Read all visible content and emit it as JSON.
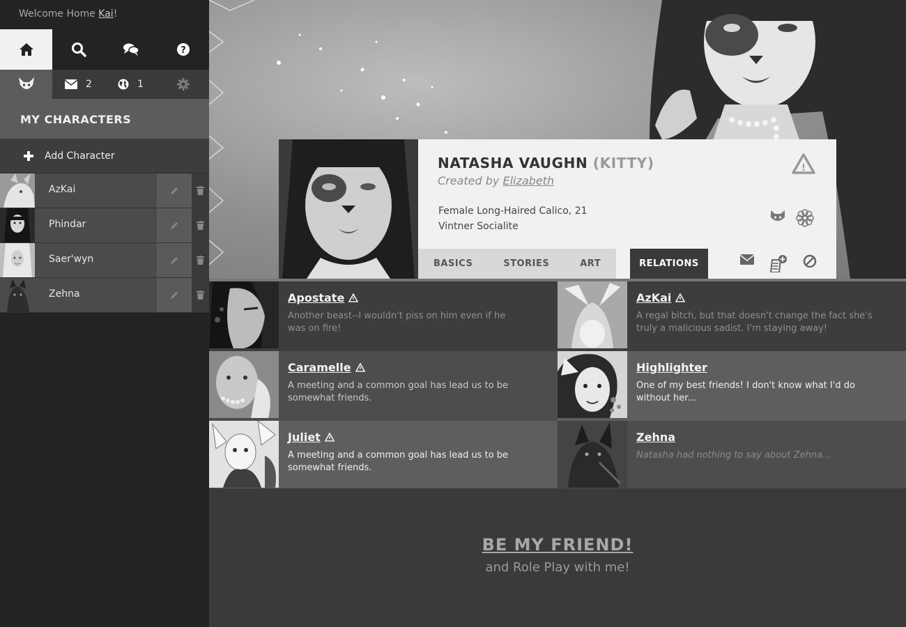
{
  "app": {
    "welcome_prefix": "Welcome Home ",
    "username": "Kai",
    "welcome_suffix": "!"
  },
  "nav": {
    "items": [
      {
        "name": "home-icon",
        "active": true
      },
      {
        "name": "search-icon",
        "active": false
      },
      {
        "name": "chat-icon",
        "active": false
      },
      {
        "name": "help-icon",
        "active": false
      }
    ],
    "mail_count": "2",
    "globe_count": "1"
  },
  "sidebar": {
    "section_title": "MY CHARACTERS",
    "add_label": "Add Character",
    "characters": [
      {
        "name": "AzKai"
      },
      {
        "name": "Phindar"
      },
      {
        "name": "Saer'wyn"
      },
      {
        "name": "Zehna"
      }
    ]
  },
  "profile": {
    "name": "NATASHA VAUGHN",
    "nickname": "(KITTY)",
    "created_prefix": "Created by ",
    "creator": "Elizabeth",
    "desc_line1": "Female Long-Haired Calico, 21",
    "desc_line2": "Vintner Socialite",
    "tabs": [
      "BASICS",
      "STORIES",
      "ART",
      "RELATIONS"
    ],
    "active_tab": "RELATIONS"
  },
  "relations": [
    {
      "name": "Apostate",
      "warning": true,
      "text": "Another beast--I wouldn't piss on him even if he was on fire!",
      "style": "muted"
    },
    {
      "name": "AzKai",
      "warning": true,
      "text": "A regal bitch, but that doesn't change the fact she's truly a malicious sadist. I'm staying away!",
      "style": "muted"
    },
    {
      "name": "Caramelle",
      "warning": true,
      "text": "A meeting and a common goal has lead us to be somewhat friends.",
      "style": "normal"
    },
    {
      "name": "Highlighter",
      "warning": false,
      "text": "One of my best friends! I don't know what I'd do without her...",
      "style": "bright"
    },
    {
      "name": "Juliet",
      "warning": true,
      "text": "A meeting and a common goal has lead us to be somewhat friends.",
      "style": "bright"
    },
    {
      "name": "Zehna",
      "warning": false,
      "text": "Natasha had nothing to say about Zehna...",
      "style": "italic"
    }
  ],
  "cta": {
    "title": "BE MY FRIEND!",
    "subtitle": "and Role Play with me!"
  },
  "colors": {
    "sidebar_bg": "#232323",
    "panel": "#f1f1f1",
    "active_tab": "#3a3a3a"
  }
}
